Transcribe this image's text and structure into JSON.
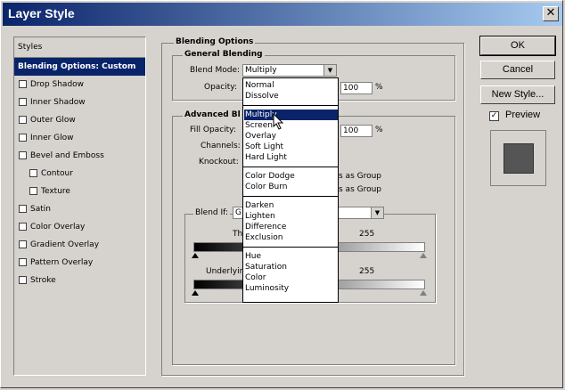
{
  "window": {
    "title": "Layer Style",
    "close_glyph": "✕"
  },
  "styles_panel": {
    "header": "Styles",
    "items": [
      {
        "label": "Blending Options: Custom",
        "selected": true,
        "checkbox": false,
        "sub": false
      },
      {
        "label": "Drop Shadow",
        "checkbox": true,
        "sub": false
      },
      {
        "label": "Inner Shadow",
        "checkbox": true,
        "sub": false
      },
      {
        "label": "Outer Glow",
        "checkbox": true,
        "sub": false
      },
      {
        "label": "Inner Glow",
        "checkbox": true,
        "sub": false
      },
      {
        "label": "Bevel and Emboss",
        "checkbox": true,
        "sub": false
      },
      {
        "label": "Contour",
        "checkbox": true,
        "sub": true
      },
      {
        "label": "Texture",
        "checkbox": true,
        "sub": true
      },
      {
        "label": "Satin",
        "checkbox": true,
        "sub": false
      },
      {
        "label": "Color Overlay",
        "checkbox": true,
        "sub": false
      },
      {
        "label": "Gradient Overlay",
        "checkbox": true,
        "sub": false
      },
      {
        "label": "Pattern Overlay",
        "checkbox": true,
        "sub": false
      },
      {
        "label": "Stroke",
        "checkbox": true,
        "sub": false
      }
    ]
  },
  "blending": {
    "section_title": "Blending Options",
    "general_title": "General Blending",
    "blend_mode_label": "Blend Mode:",
    "blend_mode_value": "Multiply",
    "opacity_label": "Opacity:",
    "opacity_value": "100",
    "percent": "%",
    "advanced_title": "Advanced Bl",
    "fill_opacity_label": "Fill Opacity:",
    "fill_opacity_value": "100",
    "channels_label": "Channels:",
    "knockout_label": "Knockout:",
    "as_group_1": "s as Group",
    "as_group_2": "s as Group",
    "blend_if_label": "Blend If:",
    "blend_if_value": "G",
    "this_layer_label": "Th",
    "this_layer_max": "255",
    "underlying_label": "Underlyin",
    "underlying_max": "255"
  },
  "blend_modes": [
    [
      "Normal",
      "Dissolve"
    ],
    [
      "Multiply",
      "Screen",
      "Overlay",
      "Soft Light",
      "Hard Light"
    ],
    [
      "Color Dodge",
      "Color Burn"
    ],
    [
      "Darken",
      "Lighten",
      "Difference",
      "Exclusion"
    ],
    [
      "Hue",
      "Saturation",
      "Color",
      "Luminosity"
    ]
  ],
  "highlighted_mode": "Multiply",
  "buttons": {
    "ok": "OK",
    "cancel": "Cancel",
    "new_style": "New Style..."
  },
  "preview": {
    "label": "Preview",
    "checked": true,
    "check_glyph": "✓"
  }
}
